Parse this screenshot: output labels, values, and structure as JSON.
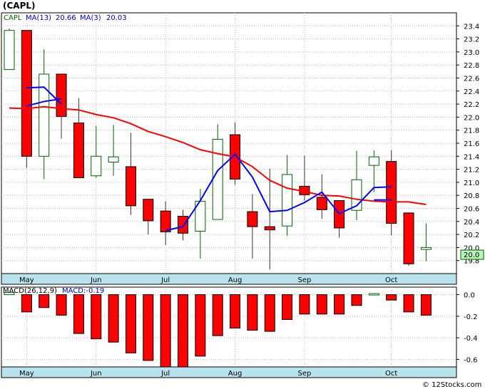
{
  "title": "(CAPL)",
  "watermark": "© 12Stocks.com",
  "colors": {
    "bull_fill": "#ffffff",
    "bull_stroke": "#006400",
    "bear": "#ff0000",
    "ma13": "#ff0000",
    "ma3": "#0000ff",
    "panel_bg": "#ffffff",
    "axis_band": "#b8e3ec",
    "grid": "#bbbbbb",
    "last_price_bg": "#b9f5b9"
  },
  "price_legend": {
    "ticker": "CAPL",
    "ma13_label": "MA(13)",
    "ma13_value": "20.66",
    "ma3_label": "MA(3)",
    "ma3_value": "20.03"
  },
  "macd_legend": {
    "label": "MACD(26,12,9)",
    "value_label": "MACD:-0.19"
  },
  "last_price_label": "20.0",
  "chart_data": [
    {
      "type": "candlestick",
      "title": "",
      "ylim": [
        19.6,
        23.6
      ],
      "y_ticks": [
        "23.4",
        "23.2",
        "23.0",
        "22.8",
        "22.6",
        "22.4",
        "22.2",
        "22.0",
        "21.8",
        "21.6",
        "21.4",
        "21.2",
        "21.0",
        "20.8",
        "20.6",
        "20.4",
        "20.2",
        "20.0",
        "19.8"
      ],
      "x_labels": [
        "May",
        "Jun",
        "Jul",
        "Aug",
        "Sep",
        "Oct"
      ],
      "x_label_weeks": [
        1,
        5,
        9,
        13,
        17,
        22
      ],
      "candles": [
        {
          "week": 0,
          "open": 22.73,
          "high": 23.36,
          "low": 22.78,
          "close": 23.33
        },
        {
          "week": 1,
          "open": 23.33,
          "high": 23.33,
          "low": 21.22,
          "close": 21.4
        },
        {
          "week": 2,
          "open": 21.4,
          "high": 23.04,
          "low": 21.05,
          "close": 22.66
        },
        {
          "week": 3,
          "open": 22.66,
          "high": 22.66,
          "low": 21.67,
          "close": 22.01
        },
        {
          "week": 4,
          "open": 21.91,
          "high": 22.29,
          "low": 21.07,
          "close": 21.07
        },
        {
          "week": 5,
          "open": 21.1,
          "high": 21.86,
          "low": 21.07,
          "close": 21.4
        },
        {
          "week": 6,
          "open": 21.31,
          "high": 21.88,
          "low": 21.1,
          "close": 21.39
        },
        {
          "week": 7,
          "open": 21.24,
          "high": 21.76,
          "low": 20.5,
          "close": 20.64
        },
        {
          "week": 8,
          "open": 20.74,
          "high": 20.74,
          "low": 20.2,
          "close": 20.41
        },
        {
          "week": 9,
          "open": 20.56,
          "high": 20.71,
          "low": 20.04,
          "close": 20.24
        },
        {
          "week": 10,
          "open": 20.48,
          "high": 20.58,
          "low": 20.11,
          "close": 20.22
        },
        {
          "week": 11,
          "open": 20.25,
          "high": 20.9,
          "low": 19.83,
          "close": 20.71
        },
        {
          "week": 12,
          "open": 20.43,
          "high": 21.89,
          "low": 20.43,
          "close": 21.66
        },
        {
          "week": 13,
          "open": 21.73,
          "high": 21.92,
          "low": 20.96,
          "close": 21.05
        },
        {
          "week": 14,
          "open": 20.55,
          "high": 20.82,
          "low": 19.83,
          "close": 20.32
        },
        {
          "week": 15,
          "open": 20.32,
          "high": 21.21,
          "low": 19.66,
          "close": 20.27
        },
        {
          "week": 16,
          "open": 20.33,
          "high": 21.42,
          "low": 20.18,
          "close": 21.12
        },
        {
          "week": 17,
          "open": 20.94,
          "high": 21.41,
          "low": 20.72,
          "close": 20.81
        },
        {
          "week": 18,
          "open": 20.77,
          "high": 21.12,
          "low": 20.44,
          "close": 20.58
        },
        {
          "week": 19,
          "open": 20.72,
          "high": 20.72,
          "low": 20.15,
          "close": 20.3
        },
        {
          "week": 20,
          "open": 20.57,
          "high": 21.48,
          "low": 20.42,
          "close": 21.04
        },
        {
          "week": 21,
          "open": 21.26,
          "high": 21.49,
          "low": 20.85,
          "close": 21.39
        },
        {
          "week": 22,
          "open": 21.32,
          "high": 21.49,
          "low": 20.19,
          "close": 20.37
        },
        {
          "week": 23,
          "open": 20.53,
          "high": 20.54,
          "low": 19.72,
          "close": 19.75
        },
        {
          "week": 24,
          "open": 19.97,
          "high": 20.37,
          "low": 19.79,
          "close": 20.0
        }
      ],
      "series": [
        {
          "name": "MA(13)",
          "weeks": [
            0,
            1,
            2,
            3,
            4,
            5,
            6,
            7,
            8,
            9,
            10,
            11,
            12,
            13,
            14,
            15,
            16,
            17,
            18,
            19,
            20,
            21,
            22,
            23,
            24
          ],
          "values": [
            22.14,
            22.13,
            22.16,
            22.13,
            22.11,
            22.04,
            21.99,
            21.9,
            21.78,
            21.7,
            21.61,
            21.5,
            21.44,
            21.39,
            21.24,
            21.03,
            20.91,
            20.86,
            20.8,
            20.79,
            20.74,
            20.71,
            20.7,
            20.7,
            20.66
          ]
        },
        {
          "name": "MA(3)",
          "weeks": [
            9,
            10,
            11,
            12,
            13,
            14,
            15,
            16,
            17,
            18,
            19,
            20,
            21,
            22
          ],
          "values": [
            20.26,
            20.32,
            20.72,
            21.18,
            21.43,
            21.08,
            20.55,
            20.57,
            20.69,
            20.85,
            20.52,
            20.64,
            20.92,
            20.93
          ]
        },
        {
          "name": "MA(3)",
          "weeks": [
            1,
            2,
            3
          ],
          "values": [
            22.45,
            22.46,
            22.2
          ]
        },
        {
          "name": "MA(3)",
          "weeks": [
            1,
            2,
            3
          ],
          "values": [
            22.17,
            22.24,
            22.28
          ]
        },
        {
          "name": "MA(3)",
          "weeks": [
            21,
            22
          ],
          "values": [
            20.73,
            20.73
          ]
        }
      ]
    },
    {
      "type": "bar",
      "title": "",
      "ylim": [
        -0.67,
        0.07
      ],
      "y_ticks": [
        "0.0",
        "-0.2",
        "-0.4",
        "-0.6"
      ],
      "x_labels": [
        "May",
        "Jun",
        "Jul",
        "Aug",
        "Sep",
        "Oct"
      ],
      "weeks": [
        0,
        1,
        2,
        3,
        4,
        5,
        6,
        7,
        8,
        9,
        10,
        11,
        12,
        13,
        14,
        15,
        16,
        17,
        18,
        19,
        20,
        21,
        22,
        23,
        24
      ],
      "values": [
        0.02,
        -0.16,
        -0.12,
        -0.19,
        -0.36,
        -0.41,
        -0.44,
        -0.54,
        -0.61,
        -0.68,
        -0.67,
        -0.57,
        -0.38,
        -0.31,
        -0.33,
        -0.34,
        -0.23,
        -0.18,
        -0.18,
        -0.18,
        -0.1,
        0.01,
        -0.05,
        -0.16,
        -0.19
      ]
    }
  ]
}
